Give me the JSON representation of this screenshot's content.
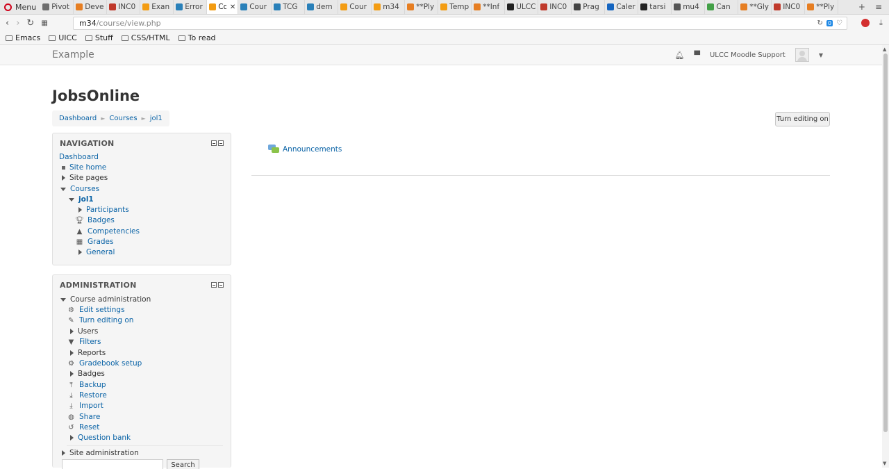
{
  "browser": {
    "menu_label": "Menu",
    "tabs": [
      {
        "label": "Pivot",
        "color": "#6d6d6d"
      },
      {
        "label": "Deve",
        "color": "#e67e22"
      },
      {
        "label": "INC0",
        "color": "#c0392b"
      },
      {
        "label": "Exan",
        "color": "#f39c12"
      },
      {
        "label": "Error",
        "color": "#2980b9"
      },
      {
        "label": "Co",
        "color": "#f39c12",
        "active": true
      },
      {
        "label": "Cour",
        "color": "#2980b9"
      },
      {
        "label": "TCG",
        "color": "#2980b9"
      },
      {
        "label": "dem",
        "color": "#2980b9"
      },
      {
        "label": "Cour",
        "color": "#f39c12"
      },
      {
        "label": "m34",
        "color": "#f39c12"
      },
      {
        "label": "**Ply",
        "color": "#e67e22"
      },
      {
        "label": "Temp",
        "color": "#f39c12"
      },
      {
        "label": "**Inf",
        "color": "#e67e22"
      },
      {
        "label": "ULCC",
        "color": "#222222"
      },
      {
        "label": "INC0",
        "color": "#c0392b"
      },
      {
        "label": "Prag",
        "color": "#444444"
      },
      {
        "label": "Caler",
        "color": "#1565c0"
      },
      {
        "label": "tarsi",
        "color": "#222222"
      },
      {
        "label": "mu4",
        "color": "#555555"
      },
      {
        "label": "Can",
        "color": "#43a047"
      },
      {
        "label": "**Gly",
        "color": "#e67e22"
      },
      {
        "label": "INC0",
        "color": "#c0392b"
      },
      {
        "label": "**Ply",
        "color": "#e67e22"
      }
    ],
    "new_tab": "+",
    "tab_menu": "≡",
    "url_host": "m34",
    "url_path": "/course/view.php",
    "url_badge": "0",
    "bookmarks": [
      "Emacs",
      "UICC",
      "Stuff",
      "CSS/HTML",
      "To read"
    ]
  },
  "moodle": {
    "site_name": "Example",
    "user_name": "ULCC Moodle Support",
    "page_title": "JobsOnline",
    "breadcrumb": [
      "Dashboard",
      "Courses",
      "jol1"
    ],
    "edit_button": "Turn editing on",
    "navigation": {
      "title": "NAVIGATION",
      "items": [
        {
          "label": "Dashboard"
        },
        {
          "label": "Site home"
        },
        {
          "label": "Site pages"
        },
        {
          "label": "Courses"
        },
        {
          "label": "jol1"
        },
        {
          "label": "Participants"
        },
        {
          "label": "Badges"
        },
        {
          "label": "Competencies"
        },
        {
          "label": "Grades"
        },
        {
          "label": "General"
        }
      ]
    },
    "administration": {
      "title": "ADMINISTRATION",
      "items": [
        {
          "label": "Course administration"
        },
        {
          "label": "Edit settings"
        },
        {
          "label": "Turn editing on"
        },
        {
          "label": "Users"
        },
        {
          "label": "Filters"
        },
        {
          "label": "Reports"
        },
        {
          "label": "Gradebook setup"
        },
        {
          "label": "Badges"
        },
        {
          "label": "Backup"
        },
        {
          "label": "Restore"
        },
        {
          "label": "Import"
        },
        {
          "label": "Share"
        },
        {
          "label": "Reset"
        },
        {
          "label": "Question bank"
        },
        {
          "label": "Site administration"
        }
      ],
      "search_button": "Search"
    },
    "activity": {
      "announcements": "Announcements"
    }
  }
}
